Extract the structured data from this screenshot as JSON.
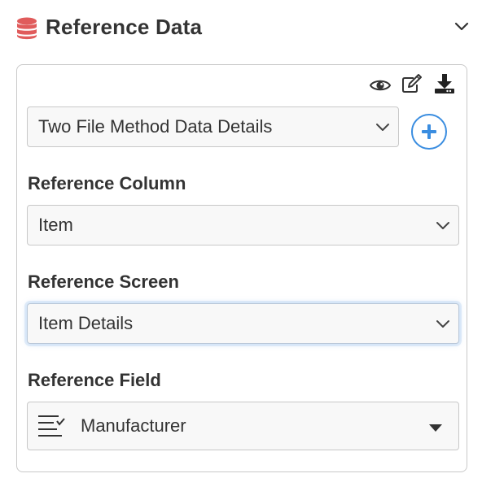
{
  "header": {
    "title": "Reference Data",
    "icon": "database-icon",
    "icon_color": "#e05b5b"
  },
  "toolbar": {
    "icons": [
      "eye-icon",
      "edit-icon",
      "download-icon"
    ]
  },
  "dataset_select": {
    "value": "Two File Method Data Details"
  },
  "add_button": {
    "icon": "plus-icon",
    "color": "#3a8de0"
  },
  "reference_column": {
    "label": "Reference Column",
    "value": "Item"
  },
  "reference_screen": {
    "label": "Reference Screen",
    "value": "Item Details"
  },
  "reference_field": {
    "label": "Reference Field",
    "value": "Manufacturer",
    "icon": "field-list-icon"
  }
}
